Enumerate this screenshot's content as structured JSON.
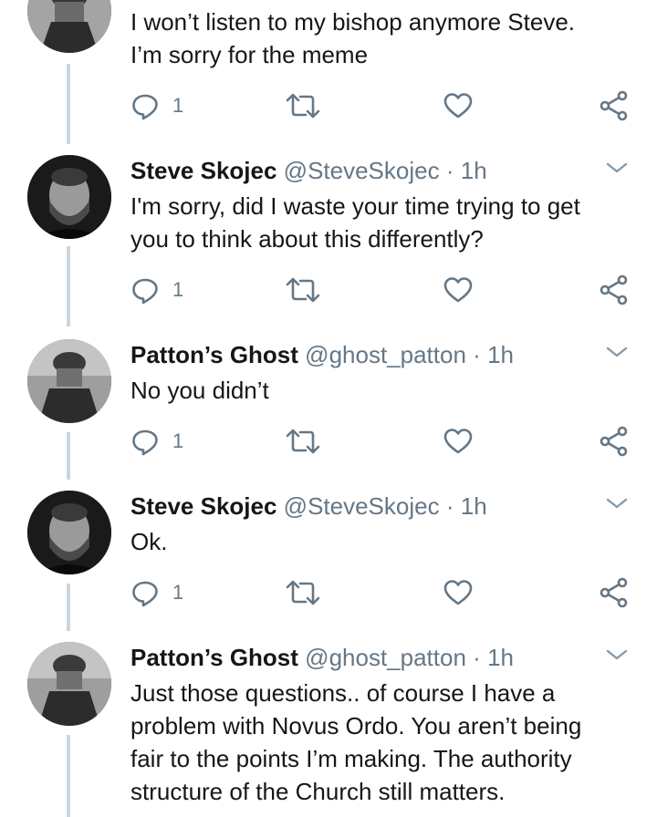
{
  "tweets": [
    {
      "name": "",
      "handle": "",
      "time": "",
      "text_lines": [
        "I won’t listen to my bishop anymore Steve.",
        "I’m sorry for the meme"
      ],
      "reply_count": "1",
      "avatar": "patton-helmet-photo"
    },
    {
      "name": "Steve Skojec",
      "handle": "@SteveSkojec",
      "dot": "·",
      "time": "1h",
      "text_lines": [
        "I'm sorry, did I waste your time trying to get",
        "you to think about this differently?"
      ],
      "reply_count": "1",
      "avatar": "bearded-man-photo"
    },
    {
      "name": "Patton’s Ghost",
      "handle": "@ghost_patton",
      "dot": "·",
      "time": "1h",
      "text_lines": [
        "No you didn’t"
      ],
      "reply_count": "1",
      "avatar": "patton-helmet-photo"
    },
    {
      "name": "Steve Skojec",
      "handle": "@SteveSkojec",
      "dot": "·",
      "time": "1h",
      "text_lines": [
        "Ok."
      ],
      "reply_count": "1",
      "avatar": "bearded-man-photo"
    },
    {
      "name": "Patton’s Ghost",
      "handle": "@ghost_patton",
      "dot": "·",
      "time": "1h",
      "text_lines": [
        "Just those questions.. of course I have a",
        "problem with Novus Ordo. You aren’t being",
        "fair to the points I’m making. The authority",
        "structure of the Church still matters."
      ],
      "avatar": "patton-helmet-photo"
    }
  ],
  "icons": {
    "reply": "reply-icon",
    "retweet": "retweet-icon",
    "like": "like-icon",
    "share": "share-icon",
    "more": "chevron-down-icon"
  },
  "colors": {
    "text": "#14171a",
    "secondary": "#657786",
    "thread_line": "#ccd6dd"
  }
}
